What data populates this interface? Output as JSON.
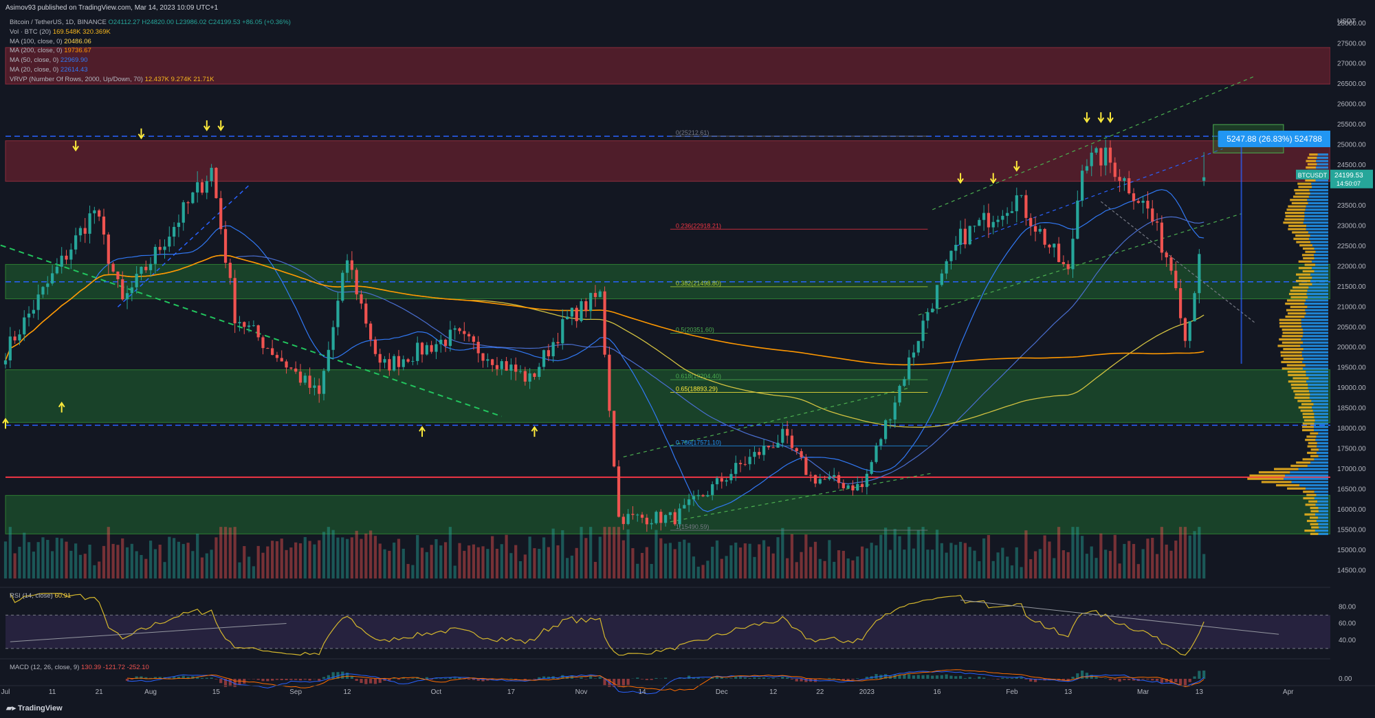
{
  "header": {
    "published": "Asimov93 published on TradingView.com, Mar 14, 2023 10:09 UTC+1"
  },
  "legend": {
    "symbol": "Bitcoin / TetherUS, 1D, BINANCE",
    "ohlc": "O24112.27 H24820.00 L23986.02 C24199.53 +86.05 (+0.36%)",
    "items": [
      {
        "label": "Vol · BTC (20)",
        "value": "169.548K 320.369K",
        "color": "#f7b71d"
      },
      {
        "label": "MA (100, close, 0)",
        "value": "20486.06",
        "color": "#ffd54f"
      },
      {
        "label": "MA (200, close, 0)",
        "value": "19736.67",
        "color": "#ff9800"
      },
      {
        "label": "MA (50, close, 0)",
        "value": "22969.90",
        "color": "#3179f5"
      },
      {
        "label": "MA (20, close, 0)",
        "value": "22614.43",
        "color": "#3179f5"
      },
      {
        "label": "VRVP (Number Of Rows, 2000, Up/Down, 70)",
        "value": "12.437K 9.274K 21.71K",
        "color": "#f7b71d"
      }
    ]
  },
  "price_axis": {
    "currency": "USDT",
    "ticks": [
      "28000.00",
      "27500.00",
      "27000.00",
      "26500.00",
      "26000.00",
      "25500.00",
      "25000.00",
      "24500.00",
      "24000.00",
      "23500.00",
      "23000.00",
      "22500.00",
      "22000.00",
      "21500.00",
      "21000.00",
      "20500.00",
      "20000.00",
      "19500.00",
      "19000.00",
      "18500.00",
      "18000.00",
      "17500.00",
      "17000.00",
      "16500.00",
      "16000.00",
      "15500.00",
      "15000.00",
      "14500.00"
    ],
    "price_label": {
      "symbol": "BTCUSDT",
      "price": "24199.53",
      "countdown": "14:50:07"
    }
  },
  "time_axis": {
    "labels": [
      "Jul",
      "11",
      "21",
      "Aug",
      "15",
      "Sep",
      "12",
      "Oct",
      "17",
      "Nov",
      "14",
      "Dec",
      "12",
      "22",
      "2023",
      "16",
      "Feb",
      "13",
      "Mar",
      "13",
      "Apr"
    ]
  },
  "fib_levels": [
    {
      "label": "0(25212.61)",
      "color": "#787b86"
    },
    {
      "label": "0.236(22918.21)",
      "color": "#f23645"
    },
    {
      "label": "0.382(21498.80)",
      "color": "#b2d235"
    },
    {
      "label": "0.5(20351.60)",
      "color": "#4caf50"
    },
    {
      "label": "0.618(19204.40)",
      "color": "#4caf50"
    },
    {
      "label": "0.65(18893.29)",
      "color": "#ffeb3b"
    },
    {
      "label": "0.786(17571.10)",
      "color": "#2196f3"
    },
    {
      "label": "1(15490.59)",
      "color": "#787b86"
    }
  ],
  "measure_label": "5247.88 (26.83%) 524788",
  "rsi": {
    "label": "RSI (14, close)",
    "value": "60.91",
    "axis": [
      "80.00",
      "60.00",
      "40.00"
    ]
  },
  "macd": {
    "label": "MACD (12, 26, close, 9)",
    "values": "130.39 -121.72 -252.10",
    "axis": [
      "0.00"
    ]
  },
  "footer": {
    "brand": "TradingView"
  },
  "colors": {
    "up": "#26a69a",
    "down": "#ef5350",
    "bg": "#131722",
    "resistance_zone": "#5b1e2c",
    "support_zone": "#1b4a2a",
    "accent": "#2196f3"
  },
  "chart_data": {
    "type": "candlestick",
    "symbol": "BTCUSDT",
    "interval": "1D",
    "x_range": [
      "2022-07-01",
      "2023-04-10"
    ],
    "y_range": [
      14150,
      28200
    ],
    "y_scale": "linear",
    "grid": false,
    "horizontal_zones": [
      {
        "from": 24100,
        "to": 25100,
        "kind": "resistance"
      },
      {
        "from": 26500,
        "to": 27400,
        "kind": "resistance"
      },
      {
        "from": 21200,
        "to": 22050,
        "kind": "support"
      },
      {
        "from": 18150,
        "to": 19450,
        "kind": "support"
      },
      {
        "from": 15400,
        "to": 16350,
        "kind": "support"
      }
    ],
    "horizontal_lines": [
      {
        "price": 25212,
        "style": "dashed",
        "color": "#2962ff"
      },
      {
        "price": 21620,
        "style": "dashed",
        "color": "#2962ff"
      },
      {
        "price": 18080,
        "style": "dashed",
        "color": "#2962ff"
      },
      {
        "price": 16800,
        "style": "solid",
        "color": "#f23645"
      }
    ],
    "price_anchors": [
      {
        "date": "2022-07-01",
        "price": 19900
      },
      {
        "date": "2022-07-20",
        "price": 23400
      },
      {
        "date": "2022-07-26",
        "price": 21100
      },
      {
        "date": "2022-08-14",
        "price": 24400
      },
      {
        "date": "2022-08-19",
        "price": 20800
      },
      {
        "date": "2022-09-06",
        "price": 18800
      },
      {
        "date": "2022-09-12",
        "price": 22200
      },
      {
        "date": "2022-09-19",
        "price": 19500
      },
      {
        "date": "2022-10-05",
        "price": 20300
      },
      {
        "date": "2022-10-21",
        "price": 19200
      },
      {
        "date": "2022-10-29",
        "price": 20700
      },
      {
        "date": "2022-11-05",
        "price": 21300
      },
      {
        "date": "2022-11-09",
        "price": 15800
      },
      {
        "date": "2022-11-21",
        "price": 15800
      },
      {
        "date": "2022-12-05",
        "price": 17100
      },
      {
        "date": "2022-12-14",
        "price": 17800
      },
      {
        "date": "2022-12-20",
        "price": 16800
      },
      {
        "date": "2022-12-31",
        "price": 16550
      },
      {
        "date": "2023-01-14",
        "price": 20900
      },
      {
        "date": "2023-01-21",
        "price": 22700
      },
      {
        "date": "2023-02-02",
        "price": 23700
      },
      {
        "date": "2023-02-13",
        "price": 21800
      },
      {
        "date": "2023-02-16",
        "price": 24600
      },
      {
        "date": "2023-02-21",
        "price": 24700
      },
      {
        "date": "2023-03-02",
        "price": 23400
      },
      {
        "date": "2023-03-08",
        "price": 21700
      },
      {
        "date": "2023-03-10",
        "price": 20200
      },
      {
        "date": "2023-03-13",
        "price": 22100
      },
      {
        "date": "2023-03-14",
        "price": 24199.53
      }
    ],
    "moving_averages": [
      {
        "name": "MA (20, close, 0)",
        "last": 22614.43
      },
      {
        "name": "MA (50, close, 0)",
        "last": 22969.9
      },
      {
        "name": "MA (100, close, 0)",
        "last": 20486.06
      },
      {
        "name": "MA (200, close, 0)",
        "last": 19736.67
      }
    ],
    "last": {
      "open": 24112.27,
      "high": 24820.0,
      "low": 23986.02,
      "close": 24199.53
    }
  }
}
